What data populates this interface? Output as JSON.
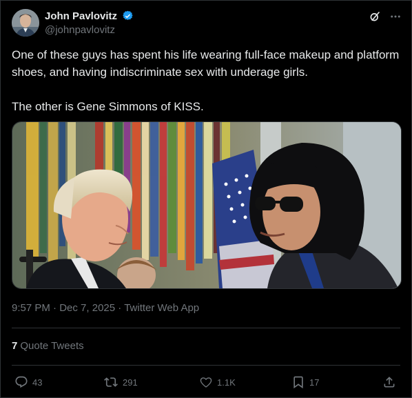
{
  "author": {
    "display_name": "John Pavlovitz",
    "handle": "@johnpavlovitz"
  },
  "header_icons": [
    "grok-icon",
    "more-icon"
  ],
  "tweet": {
    "text_line1": "One of these guys has spent his life wearing full-face makeup and platform shoes, and having indiscriminate sex with underage girls.",
    "text_line2": "The other is Gene Simmons of KISS.",
    "time": "9:57 PM",
    "separator": "·",
    "date": "Dec 7, 2025",
    "source": "Twitter Web App"
  },
  "quotes": {
    "count": "7",
    "label": "Quote Tweets"
  },
  "actions": {
    "replies": "43",
    "retweets": "291",
    "likes": "1.1K",
    "bookmarks": "17"
  },
  "colors": {
    "background": "#000000",
    "text": "#e7e9ea",
    "muted": "#71767b",
    "border": "#2f3336",
    "verified": "#1d9bf0"
  }
}
